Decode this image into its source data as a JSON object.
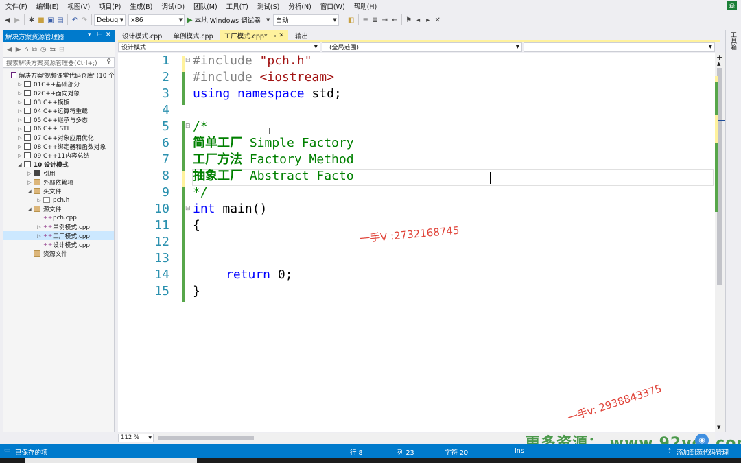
{
  "menu": [
    "文件(F)",
    "编辑(E)",
    "视图(V)",
    "项目(P)",
    "生成(B)",
    "调试(D)",
    "团队(M)",
    "工具(T)",
    "测试(S)",
    "分析(N)",
    "窗口(W)",
    "帮助(H)"
  ],
  "account_badge": "磊",
  "toolbar": {
    "config": "Debug",
    "platform": "x86",
    "run_label": "本地 Windows 调试器",
    "mode": "自动"
  },
  "solution_explorer": {
    "title": "解决方案资源管理器",
    "search_placeholder": "搜索解决方案资源管理器(Ctrl+;)",
    "items": [
      {
        "label": "解决方案'视频课堂代码仓库' (10 个",
        "indent": 0,
        "icon": "solution-icon",
        "exp": ""
      },
      {
        "label": "01C++基础部分",
        "indent": 1,
        "icon": "project-icon",
        "exp": "▷"
      },
      {
        "label": "02C++面向对象",
        "indent": 1,
        "icon": "project-icon",
        "exp": "▷"
      },
      {
        "label": "03 C++模板",
        "indent": 1,
        "icon": "project-icon",
        "exp": "▷"
      },
      {
        "label": "04 C++运算符重载",
        "indent": 1,
        "icon": "project-icon",
        "exp": "▷"
      },
      {
        "label": "05 C++继承与多态",
        "indent": 1,
        "icon": "project-icon",
        "exp": "▷"
      },
      {
        "label": "06 C++ STL",
        "indent": 1,
        "icon": "project-icon",
        "exp": "▷"
      },
      {
        "label": "07 C++对象应用优化",
        "indent": 1,
        "icon": "project-icon",
        "exp": "▷"
      },
      {
        "label": "08 C++绑定器和函数对象",
        "indent": 1,
        "icon": "project-icon",
        "exp": "▷"
      },
      {
        "label": "09 C++11内容总结",
        "indent": 1,
        "icon": "project-icon",
        "exp": "▷"
      },
      {
        "label": "10 设计模式",
        "indent": 1,
        "icon": "project-icon",
        "exp": "◢",
        "bold": true
      },
      {
        "label": "引用",
        "indent": 2,
        "icon": "references-icon",
        "exp": "▷"
      },
      {
        "label": "外部依赖项",
        "indent": 2,
        "icon": "folder-icon",
        "exp": "▷"
      },
      {
        "label": "头文件",
        "indent": 2,
        "icon": "folder-icon",
        "exp": "◢"
      },
      {
        "label": "pch.h",
        "indent": 3,
        "icon": "header-file-icon",
        "exp": "▷"
      },
      {
        "label": "源文件",
        "indent": 2,
        "icon": "folder-icon",
        "exp": "◢"
      },
      {
        "label": "pch.cpp",
        "indent": 3,
        "icon": "cpp-file-icon",
        "exp": ""
      },
      {
        "label": "单例模式.cpp",
        "indent": 3,
        "icon": "cpp-file-icon",
        "exp": "▷"
      },
      {
        "label": "工厂模式.cpp",
        "indent": 3,
        "icon": "cpp-file-icon",
        "exp": "▷",
        "selected": true
      },
      {
        "label": "设计模式.cpp",
        "indent": 3,
        "icon": "cpp-file-icon",
        "exp": ""
      },
      {
        "label": "资源文件",
        "indent": 2,
        "icon": "folder-icon",
        "exp": ""
      }
    ]
  },
  "tabs": [
    {
      "label": "设计模式.cpp",
      "active": false
    },
    {
      "label": "单例模式.cpp",
      "active": false
    },
    {
      "label": "工厂模式.cpp*",
      "active": true
    },
    {
      "label": "输出",
      "active": false
    }
  ],
  "navbar": {
    "project": "设计模式",
    "scope": "(全局范围)",
    "member": ""
  },
  "code_lines": [
    {
      "n": "1"
    },
    {
      "n": "2"
    },
    {
      "n": "3"
    },
    {
      "n": "4"
    },
    {
      "n": "5"
    },
    {
      "n": "6"
    },
    {
      "n": "7"
    },
    {
      "n": "8"
    },
    {
      "n": "9"
    },
    {
      "n": "10"
    },
    {
      "n": "11"
    },
    {
      "n": "12"
    },
    {
      "n": "13"
    },
    {
      "n": "14"
    },
    {
      "n": "15"
    }
  ],
  "code": {
    "l1_kw": "#include",
    "l1_str": "\"pch.h\"",
    "l2_kw": "#include",
    "l2_str": "<iostream>",
    "l3_a": "using",
    "l3_b": "namespace",
    "l3_c": " std;",
    "l5": "/*",
    "l6_cn": "简单工厂",
    "l6_en": " Simple Factory",
    "l7_cn": "工厂方法",
    "l7_en": " Factory Method",
    "l8_cn": "抽象工厂",
    "l8_en": " Abstract Facto",
    "l9": "*/",
    "l10_kw": "int",
    "l10_rest": " main()",
    "l11": "{",
    "l14_kw": "return",
    "l14_rest": " 0;",
    "l15": "}"
  },
  "watermarks": {
    "contact1": "一手V :2732168745",
    "contact2": "一手v: 2938843375",
    "site": "更多资源： www.92ydl.com"
  },
  "editor": {
    "zoom": "112 %"
  },
  "right_panel": {
    "label": "工具箱"
  },
  "status": {
    "left": "已保存的项",
    "line": "行 8",
    "col": "列 23",
    "char": "字符 20",
    "ins": "Ins",
    "source_control": "添加到源代码管理"
  }
}
